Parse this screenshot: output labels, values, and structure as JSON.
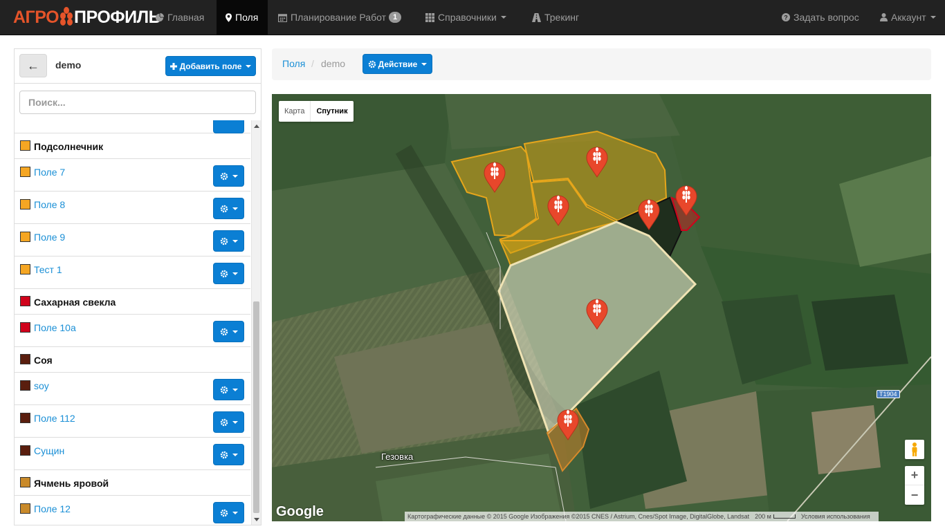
{
  "navbar": {
    "logo_left": "АГРО",
    "logo_right": "ПРОФИЛЬ",
    "items": [
      {
        "label": "Главная"
      },
      {
        "label": "Поля"
      },
      {
        "label": "Планирование Работ",
        "badge": "1"
      },
      {
        "label": "Справочники"
      },
      {
        "label": "Трекинг"
      }
    ],
    "help": "Задать вопрос",
    "account": "Аккаунт"
  },
  "panel": {
    "back": "←",
    "title": "demo",
    "add_button": "Добавить поле",
    "search_placeholder": "Поиск...",
    "groups": [
      {
        "name": "Подсолнечник",
        "color": "#f5a623",
        "fields": [
          "Поле 7",
          "Поле 8",
          "Поле 9",
          "Тест 1"
        ]
      },
      {
        "name": "Сахарная свекла",
        "color": "#d0021b",
        "fields": [
          "Поле 10а"
        ]
      },
      {
        "name": "Соя",
        "color": "#5a1e0e",
        "fields": [
          "soy",
          "Поле 112",
          "Сущин"
        ]
      },
      {
        "name": "Ячмень яровой",
        "color": "#c98a2a",
        "fields": [
          "Поле 12"
        ]
      }
    ]
  },
  "breadcrumb": {
    "root": "Поля",
    "separator": "/",
    "current": "demo",
    "action": "Действие"
  },
  "map": {
    "type_map": "Карта",
    "type_satellite": "Спутник",
    "village": "Гезовка",
    "road": "T1904",
    "google": "Google",
    "attribution": "Картографические данные © 2015 Google Изображения ©2015 CNES / Astrium, Cnes/Spot Image, DigitalGlobe, Landsat",
    "scale": "200 м",
    "terms": "Условия использования",
    "zoom_in": "+",
    "zoom_out": "−"
  }
}
